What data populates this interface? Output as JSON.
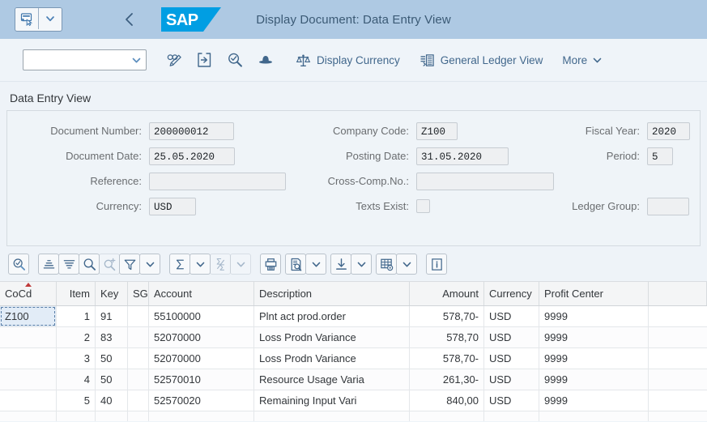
{
  "shellbar": {
    "title": "Display Document: Data Entry View",
    "logo_text": "SAP",
    "menu_icon": "comment-cursor-icon",
    "menu_dropdown_icon": "chevron-down-icon",
    "back_icon": "navigate-back-icon"
  },
  "toolbar": {
    "combo_value": "",
    "combo_placeholder": "",
    "icons": [
      {
        "name": "display-change-icon",
        "title": "Display/Change"
      },
      {
        "name": "enter-document-icon",
        "title": "Other Document"
      },
      {
        "name": "search-check-icon",
        "title": "Document Overview"
      },
      {
        "name": "hat-icon",
        "title": "Expert Mode"
      }
    ],
    "display_currency_label": "Display Currency",
    "display_currency_icon": "balance-scale-icon",
    "general_ledger_label": "General Ledger View",
    "general_ledger_icon": "ledger-list-icon",
    "more_label": "More",
    "more_icon": "chevron-down-icon"
  },
  "form": {
    "section_title": "Data Entry View",
    "fields": {
      "document_number_label": "Document Number:",
      "document_number_value": "200000012",
      "document_date_label": "Document Date:",
      "document_date_value": "25.05.2020",
      "reference_label": "Reference:",
      "reference_value": "",
      "currency_label": "Currency:",
      "currency_value": "USD",
      "company_code_label": "Company Code:",
      "company_code_value": "Z100",
      "posting_date_label": "Posting Date:",
      "posting_date_value": "31.05.2020",
      "cross_comp_label": "Cross-Comp.No.:",
      "cross_comp_value": "",
      "texts_exist_label": "Texts Exist:",
      "texts_exist_checked": false,
      "fiscal_year_label": "Fiscal Year:",
      "fiscal_year_value": "2020",
      "period_label": "Period:",
      "period_value": "5",
      "ledger_group_label": "Ledger Group:",
      "ledger_group_value": ""
    }
  },
  "table_toolbar": {
    "buttons": [
      {
        "name": "find-icon",
        "group": 0,
        "disabled": false
      },
      {
        "name": "sort-ascending-icon",
        "group": 1,
        "disabled": false
      },
      {
        "name": "sort-descending-icon",
        "group": 1,
        "disabled": false
      },
      {
        "name": "search-icon",
        "group": 1,
        "disabled": false
      },
      {
        "name": "search-next-icon",
        "group": 1,
        "disabled": true
      },
      {
        "name": "filter-icon",
        "group": 1,
        "disabled": false
      },
      {
        "name": "filter-dropdown-icon",
        "group": 1,
        "disabled": false
      },
      {
        "name": "total-sum-icon",
        "group": 2,
        "disabled": false
      },
      {
        "name": "total-sum-dropdown-icon",
        "group": 2,
        "disabled": false
      },
      {
        "name": "subtotal-icon",
        "group": 2,
        "disabled": true
      },
      {
        "name": "subtotal-dropdown-icon",
        "group": 2,
        "disabled": true
      },
      {
        "name": "print-icon",
        "group": 3,
        "disabled": false
      },
      {
        "name": "view-details-icon",
        "group": 3,
        "disabled": false
      },
      {
        "name": "view-details-dropdown-icon",
        "group": 3,
        "disabled": false
      },
      {
        "name": "export-icon",
        "group": 3,
        "disabled": false
      },
      {
        "name": "export-dropdown-icon",
        "group": 3,
        "disabled": false
      },
      {
        "name": "layout-settings-icon",
        "group": 3,
        "disabled": false
      },
      {
        "name": "layout-dropdown-icon",
        "group": 3,
        "disabled": false
      },
      {
        "name": "info-icon",
        "group": 4,
        "disabled": false
      }
    ]
  },
  "table": {
    "sorted_column": "CoCd",
    "sort_direction": "ascending",
    "columns": [
      {
        "key": "cocd",
        "label": "CoCd",
        "align": "left"
      },
      {
        "key": "item",
        "label": "Item",
        "align": "right"
      },
      {
        "key": "key",
        "label": "Key",
        "align": "left"
      },
      {
        "key": "sg",
        "label": "SG",
        "align": "left"
      },
      {
        "key": "account",
        "label": "Account",
        "align": "left"
      },
      {
        "key": "desc",
        "label": "Description",
        "align": "left"
      },
      {
        "key": "amount",
        "label": "Amount",
        "align": "right"
      },
      {
        "key": "currency",
        "label": "Currency",
        "align": "left"
      },
      {
        "key": "pc",
        "label": "Profit Center",
        "align": "left"
      }
    ],
    "rows": [
      {
        "cocd": "Z100",
        "item": "1",
        "key": "91",
        "sg": "",
        "account": "55100000",
        "desc": "Plnt act prod.order",
        "amount": "578,70-",
        "currency": "USD",
        "pc": "9999"
      },
      {
        "cocd": "",
        "item": "2",
        "key": "83",
        "sg": "",
        "account": "52070000",
        "desc": "Loss Prodn Variance",
        "amount": "578,70",
        "currency": "USD",
        "pc": "9999"
      },
      {
        "cocd": "",
        "item": "3",
        "key": "50",
        "sg": "",
        "account": "52070000",
        "desc": "Loss Prodn Variance",
        "amount": "578,70-",
        "currency": "USD",
        "pc": "9999"
      },
      {
        "cocd": "",
        "item": "4",
        "key": "50",
        "sg": "",
        "account": "52570010",
        "desc": "Resource Usage Varia",
        "amount": "261,30-",
        "currency": "USD",
        "pc": "9999"
      },
      {
        "cocd": "",
        "item": "5",
        "key": "40",
        "sg": "",
        "account": "52570020",
        "desc": "Remaining Input Vari",
        "amount": "840,00",
        "currency": "USD",
        "pc": "9999"
      }
    ],
    "focused_cell": {
      "row": 0,
      "column": "cocd"
    }
  },
  "colors": {
    "shellbar_bg": "#aec9e3",
    "toolbar_bg": "#eff4f9",
    "accent": "#41678c",
    "sap_logo_blue": "#009ee3",
    "sort_marker": "#c03a3a",
    "focus_bg": "#e2ecf7"
  }
}
